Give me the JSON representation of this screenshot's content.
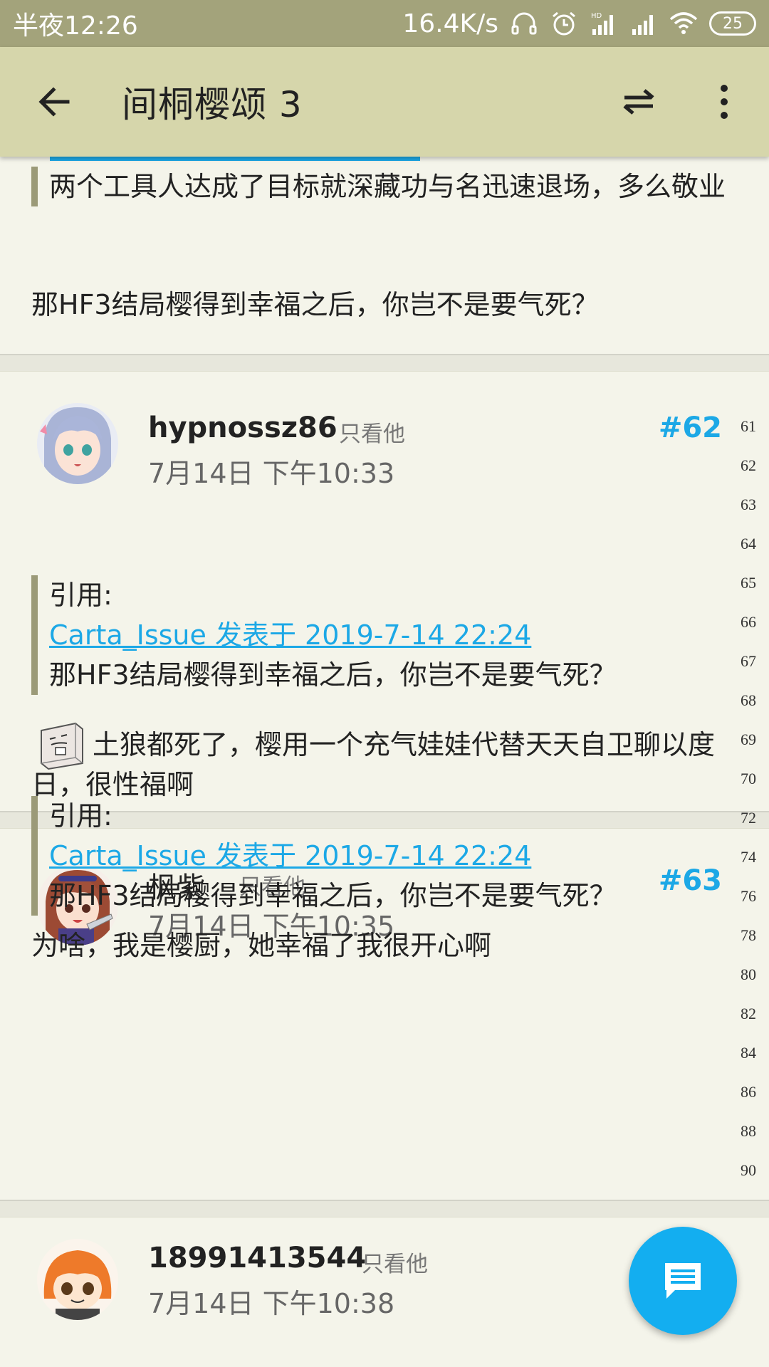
{
  "status_bar": {
    "time": "半夜12:26",
    "net_speed": "16.4K/s",
    "battery": "25"
  },
  "app_bar": {
    "title": "间桐樱颂  3"
  },
  "posts": [
    {
      "quote_text": "两个工具人达成了目标就深藏功与名迅速退场，多么敬业",
      "body": "那HF3结局樱得到幸福之后，你岂不是要气死？"
    },
    {
      "username": "hypnossz86",
      "only_him": "只看他",
      "floor": "#62",
      "date": "7月14日 下午10:33",
      "quote_label": "引用:",
      "quote_link": "Carta_Issue 发表于 2019-7-14 22:24",
      "quote_text": "那HF3结局樱得到幸福之后，你岂不是要气死？",
      "body": "土狼都死了，樱用一个充气娃娃代替天天自卫聊以度日，很性福啊"
    },
    {
      "username": "枫紫",
      "only_him": "只看他",
      "floor": "#63",
      "date": "7月14日 下午10:35",
      "quote_label": "引用:",
      "quote_link": "Carta_Issue 发表于 2019-7-14 22:24",
      "quote_text": "那HF3结局樱得到幸福之后，你岂不是要气死？",
      "body": "为啥，我是樱厨，她幸福了我很开心啊"
    },
    {
      "username": "18991413544",
      "only_him": "只看他",
      "date": "7月14日 下午10:38"
    }
  ],
  "page_index": [
    "61",
    "62",
    "63",
    "64",
    "65",
    "66",
    "67",
    "68",
    "69",
    "70",
    "72",
    "74",
    "76",
    "78",
    "80",
    "82",
    "84",
    "86",
    "88",
    "90"
  ],
  "icons": {
    "back": "arrow-left-icon",
    "swap": "swap-arrows-icon",
    "more": "more-vert-icon",
    "fab": "comment-icon",
    "emoji": "tofu-emoji-icon"
  },
  "colors": {
    "status_bar": "#a3a37b",
    "app_bar": "#d6d6ab",
    "background": "#f4f4ea",
    "accent": "#1ca8e6",
    "quote_bar": "#9b9a78"
  }
}
